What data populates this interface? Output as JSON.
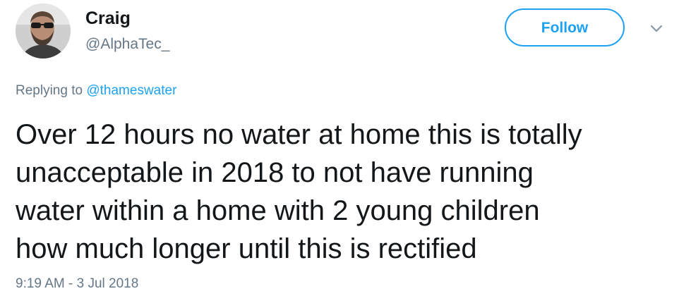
{
  "author": {
    "name": "Craig",
    "handle": "@AlphaTec_"
  },
  "follow_button": {
    "label": "Follow"
  },
  "more_menu": {
    "icon": "chevron-down-icon"
  },
  "reply": {
    "prefix": "Replying to ",
    "mention": "@thameswater"
  },
  "tweet": {
    "lines": [
      "Over 12 hours no water at home this is totally",
      "unacceptable in 2018 to not have running",
      "water within a home with 2 young children",
      "how much longer until this is rectified"
    ],
    "timestamp": "9:19 AM - 3 Jul 2018"
  },
  "colors": {
    "accent": "#1da1f2",
    "secondary_text": "#657786",
    "primary_text": "#14171a"
  }
}
